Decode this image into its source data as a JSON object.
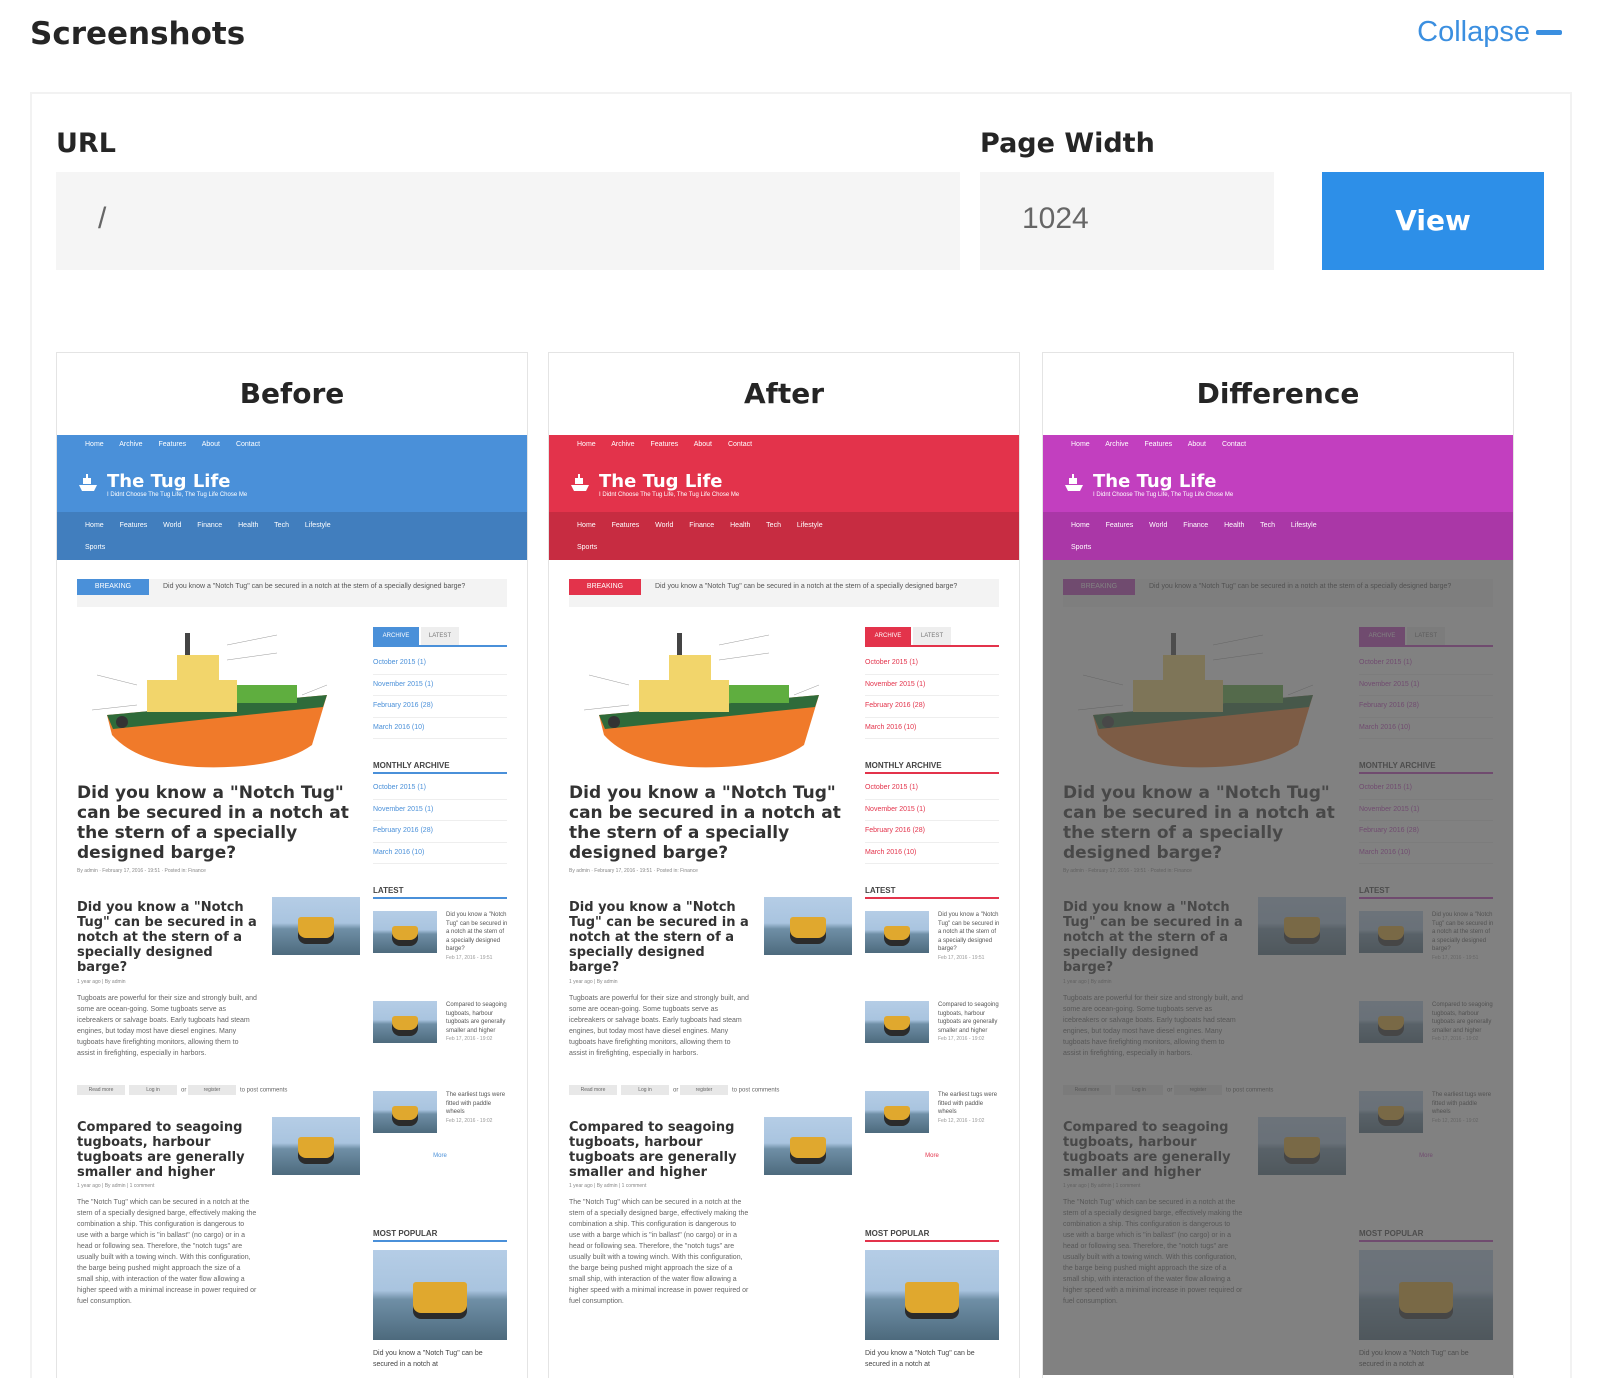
{
  "header": {
    "title": "Screenshots",
    "collapse_label": "Collapse"
  },
  "form": {
    "url_label": "URL",
    "url_value": "/",
    "width_label": "Page Width",
    "width_value": "1024",
    "view_label": "View"
  },
  "colors": {
    "before": "#4a90d9",
    "after": "#e3334b",
    "difference": "#c23fbf",
    "view_button": "#2d8fe8"
  },
  "panels": [
    {
      "title": "Before"
    },
    {
      "title": "After"
    },
    {
      "title": "Difference"
    }
  ],
  "site": {
    "topnav": "Home Archive Features About Contact",
    "brand": "The Tug Life",
    "tagline": "I Didnt Choose The Tug Life, The Tug Life Chose Me",
    "subnav": "Home Features World Finance Health Tech Lifestyle",
    "subnav2": "Sports",
    "breaking_tag": "BREAKING",
    "breaking_text": "Did you know a \"Notch Tug\" can be secured in a notch at the stern of a specially designed barge?",
    "headline": "Did you know a \"Notch Tug\" can be secured in a notch at the stern of a specially designed barge?",
    "headline_meta": "By admin · February 17, 2016 - 19:51 · Posted in: Finance",
    "post1_title": "Did you know a \"Notch Tug\" can be secured in a notch at the stern of a specially designed barge?",
    "post1_meta": "1 year ago | By admin",
    "post1_text": "Tugboats are powerful for their size and strongly built, and some are ocean-going. Some tugboats serve as icebreakers or salvage boats. Early tugboats had steam engines, but today most have diesel engines. Many tugboats have firefighting monitors, allowing them to assist in firefighting, especially in harbors.",
    "read_more": "Read more",
    "log_in": "Log in",
    "or": "or",
    "register": "register",
    "to_post": "to post comments",
    "post2_title": "Compared to seagoing tugboats, harbour tugboats are generally smaller and higher",
    "post2_meta": "1 year ago | By admin | 1 comment",
    "post2_text": "The \"Notch Tug\" which can be secured in a notch at the stern of a specially designed barge, effectively making the combination a ship. This configuration is dangerous to use with a barge which is \"in ballast\" (no cargo) or in a head or following sea. Therefore, the \"notch tugs\" are usually built with a towing winch. With this configuration, the barge being pushed might approach the size of a small ship, with interaction of the water flow allowing a higher speed with a minimal increase in power required or fuel consumption.",
    "tab_archive": "ARCHIVE",
    "tab_latest": "LATEST",
    "archive": [
      "October 2015 (1)",
      "November 2015 (1)",
      "February 2016 (28)",
      "March 2016 (10)"
    ],
    "monthly_archive": "MONTHLY ARCHIVE",
    "latest_head": "LATEST",
    "latest": [
      {
        "t": "Did you know a \"Notch Tug\" can be secured in a notch at the stern of a specially designed barge?",
        "d": "Feb 17, 2016 - 19:51"
      },
      {
        "t": "Compared to seagoing tugboats, harbour tugboats are generally smaller and higher",
        "d": "Feb 17, 2016 - 19:02"
      },
      {
        "t": "The earliest tugs were fitted with paddle wheels",
        "d": "Feb 12, 2016 - 19:02"
      }
    ],
    "more": "More",
    "popular_head": "MOST POPULAR",
    "popular_text": "Did you know a \"Notch Tug\" can be secured in a notch at"
  }
}
